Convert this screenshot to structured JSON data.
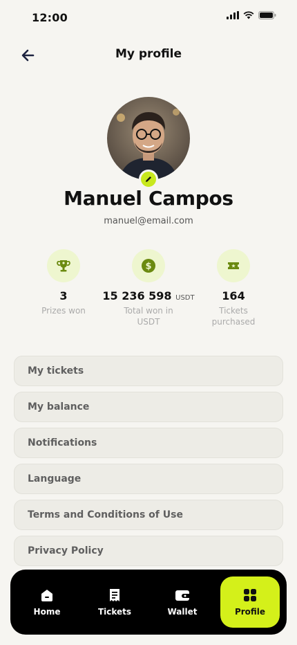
{
  "status": {
    "time": "12:00"
  },
  "header": {
    "title": "My profile"
  },
  "profile": {
    "name": "Manuel Campos",
    "email": "manuel@email.com"
  },
  "stats": [
    {
      "icon": "trophy-icon",
      "value": "3",
      "unit": "",
      "label": "Prizes won"
    },
    {
      "icon": "dollar-coin-icon",
      "value": "15 236 598",
      "unit": "USDT",
      "label": "Total won in USDT"
    },
    {
      "icon": "ticket-icon",
      "value": "164",
      "unit": "",
      "label": "Tickets purchased"
    }
  ],
  "menu": [
    {
      "label": "My tickets"
    },
    {
      "label": "My balance"
    },
    {
      "label": "Notifications"
    },
    {
      "label": "Language"
    },
    {
      "label": "Terms and Conditions of Use"
    },
    {
      "label": "Privacy Policy"
    }
  ],
  "tabs": [
    {
      "label": "Home",
      "icon": "home-icon"
    },
    {
      "label": "Tickets",
      "icon": "tickets-icon"
    },
    {
      "label": "Wallet",
      "icon": "wallet-icon"
    },
    {
      "label": "Profile",
      "icon": "grid-icon",
      "active": true
    }
  ],
  "colors": {
    "accent": "#d4f01a",
    "accent_soft": "#eef6cf",
    "icon_green": "#6b8a10",
    "background": "#f6f5f1"
  }
}
